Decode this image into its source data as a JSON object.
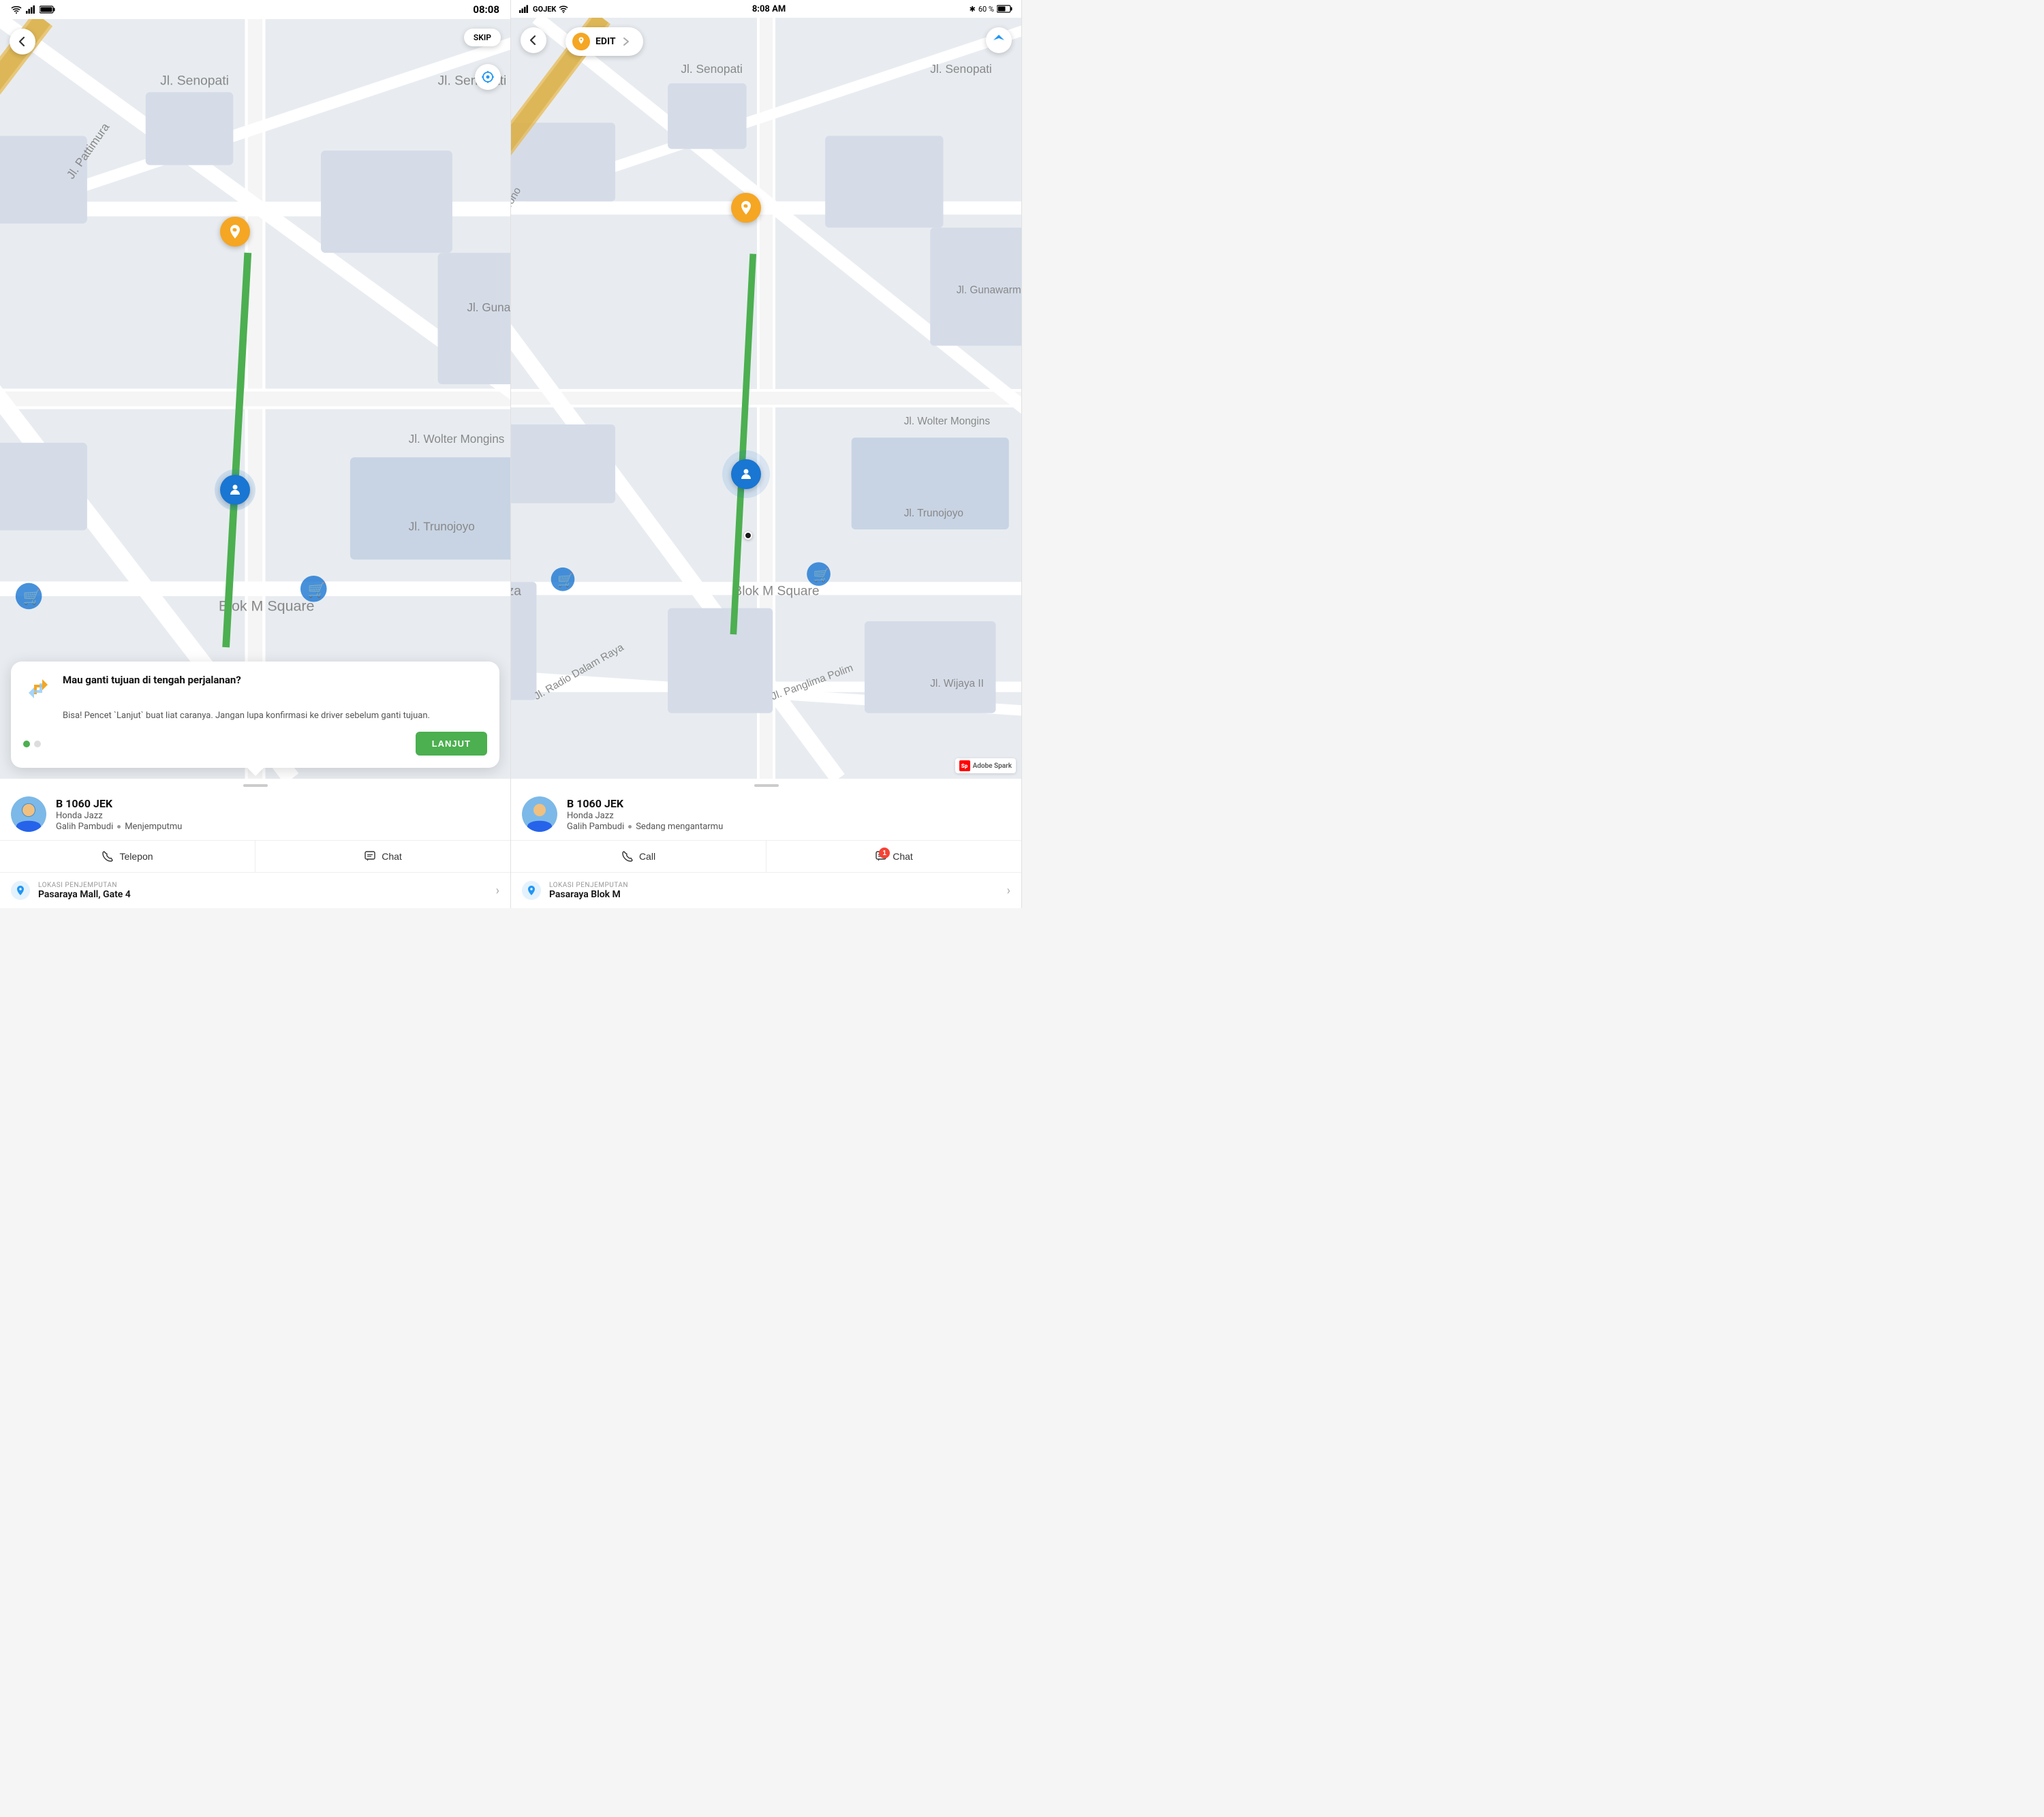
{
  "panel1": {
    "statusBar": {
      "time": "08:08",
      "icons": [
        "wifi",
        "signal",
        "battery"
      ]
    },
    "mapButtons": {
      "backLabel": "←",
      "skipLabel": "SKIP"
    },
    "popup": {
      "title": "Mau ganti tujuan di tengah perjalanan?",
      "body": "Bisa! Pencet `Lanjut` buat liat caranya. Jangan lupa konfirmasi ke driver sebelum ganti tujuan.",
      "dots": [
        true,
        false
      ],
      "btnLabel": "LANJUT"
    },
    "driver": {
      "plate": "B 1060 JEK",
      "car": "Honda Jazz",
      "name": "Galih Pambudi",
      "status": "Menjemputmu"
    },
    "actions": {
      "telepon": "Telepon",
      "chat": "Chat"
    },
    "location": {
      "label": "LOKASI PENJEMPUTAN",
      "name": "Pasaraya Mall, Gate 4"
    }
  },
  "panel2": {
    "statusBar": {
      "carrier": "GOJEK",
      "wifi": "wifi",
      "time": "8:08 AM",
      "bluetooth": "✱",
      "battery": "60 %"
    },
    "mapButtons": {
      "backLabel": "←",
      "editLabel": "EDIT",
      "locationLabel": "➤"
    },
    "driver": {
      "plate": "B 1060 JEK",
      "car": "Honda Jazz",
      "name": "Galih Pambudi",
      "status": "Sedang mengantarmu"
    },
    "actions": {
      "call": "Call",
      "chat": "Chat",
      "chatBadge": "1"
    },
    "location": {
      "label": "LOKASI PENJEMPUTAN",
      "name": "Pasaraya Blok M"
    },
    "adobeSpark": "Adobe Spark"
  }
}
